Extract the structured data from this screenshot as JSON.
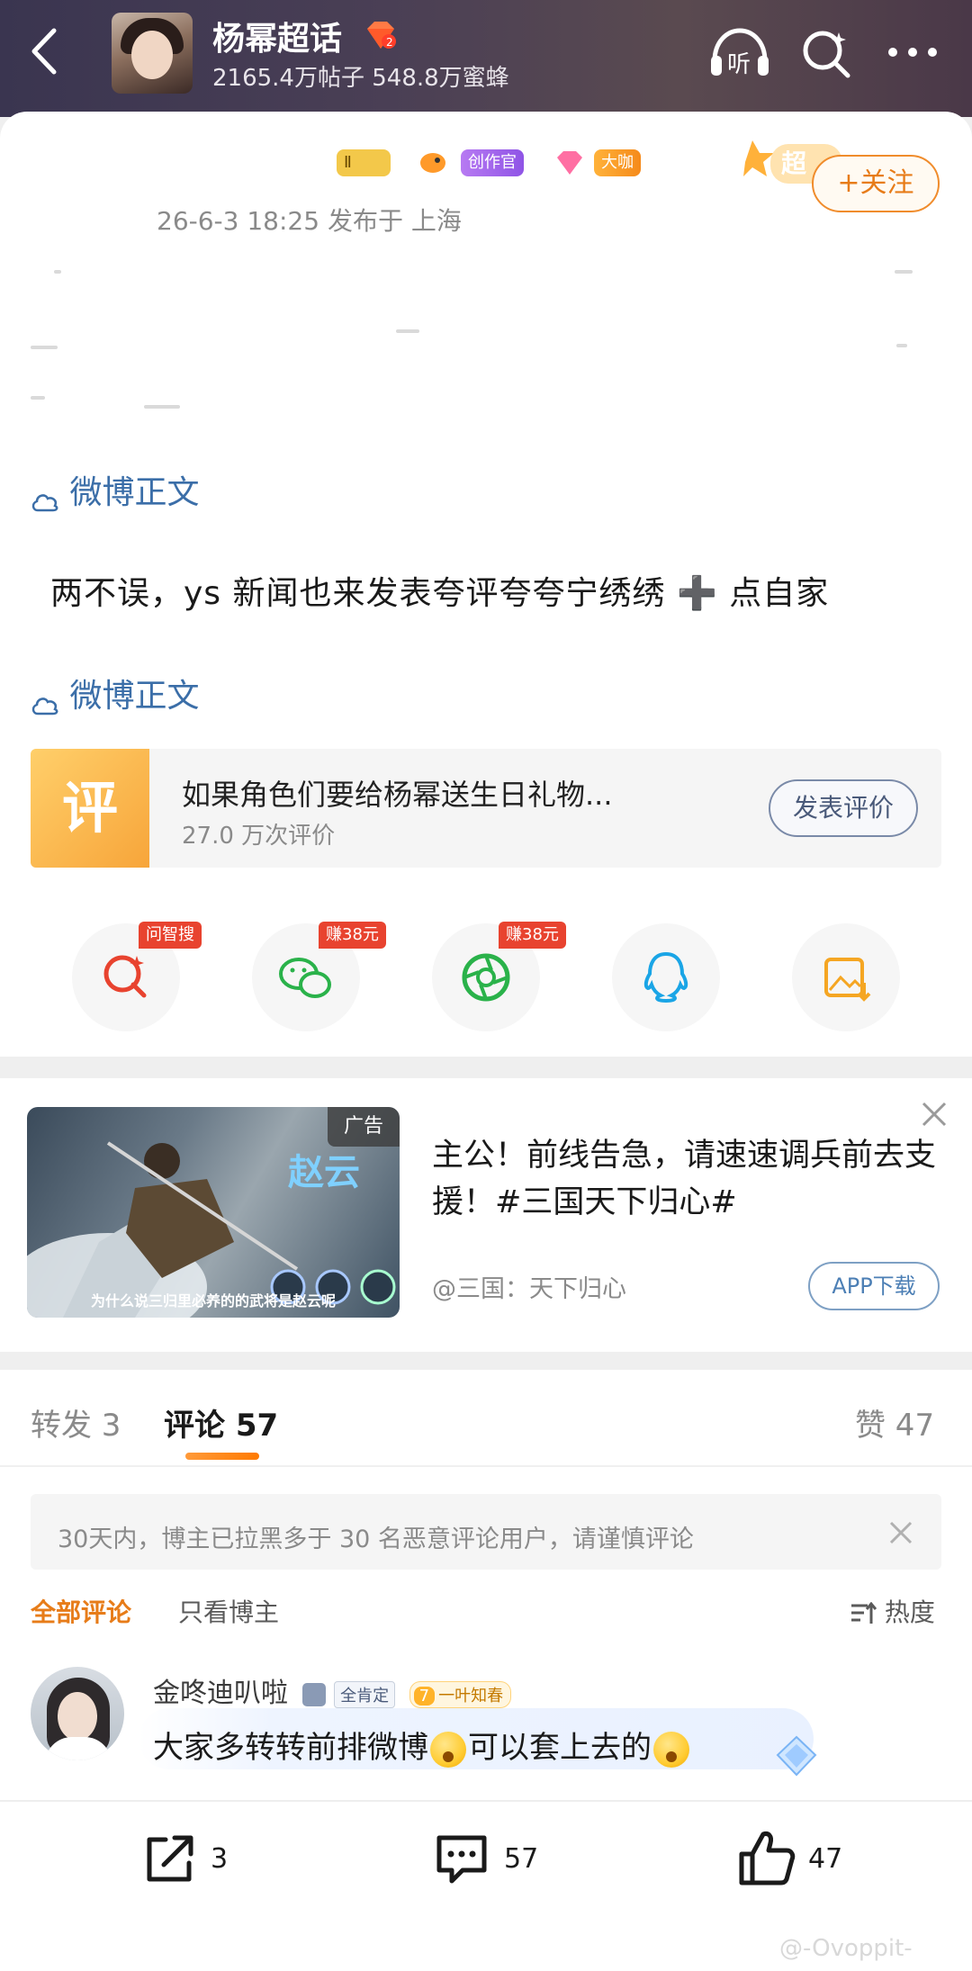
{
  "header": {
    "title": "杨幂超话",
    "stats": "2165.4万帖子 548.8万蜜蜂",
    "listen_label": "听"
  },
  "post": {
    "badges": [
      "创作官",
      "大咖"
    ],
    "meta": "26-6-3 18:25  发布于 上海",
    "follow_label": "+关注",
    "super_tag": "超",
    "section_link_1": "微博正文",
    "body_text": "两不误，ys 新闻也来发表夸评夸夸宁绣绣 ➕ 点自家",
    "section_link_2": "微博正文"
  },
  "review_card": {
    "icon_text": "评",
    "title": "如果角色们要给杨幂送生日礼物...",
    "subtitle": "27.0 万次评价",
    "button": "发表评价"
  },
  "share": {
    "tags": [
      "问智搜",
      "赚38元",
      "赚38元"
    ]
  },
  "ad": {
    "tag": "广告",
    "game_title": "赵云",
    "caption": "为什么说三归里必养的的武将是赵云呢",
    "text": "主公！前线告急，请速速调兵前去支援！#三国天下归心#",
    "source": "@三国：天下归心",
    "download": "APP下载"
  },
  "tabs": {
    "repost": "转发 3",
    "comment": "评论 57",
    "like": "赞 47"
  },
  "notice": "30天内，博主已拉黑多于 30 名恶意评论用户，请谨慎评论",
  "filters": {
    "all": "全部评论",
    "host_only": "只看博主",
    "sort": "热度"
  },
  "comment": {
    "user": "金咚迪叭啦",
    "badge_1": "全肯定",
    "badge_2": "一叶知春",
    "badge_2_level": "7",
    "text_a": "大家多转转前排微博",
    "text_b": "可以套上去的"
  },
  "bottom": {
    "share_count": "3",
    "comment_count": "57",
    "like_count": "47"
  },
  "watermark": "@-Ovoppit-",
  "colors": {
    "accent": "#e77c19",
    "link": "#3b6ea8",
    "header_bg": "#45394f"
  }
}
